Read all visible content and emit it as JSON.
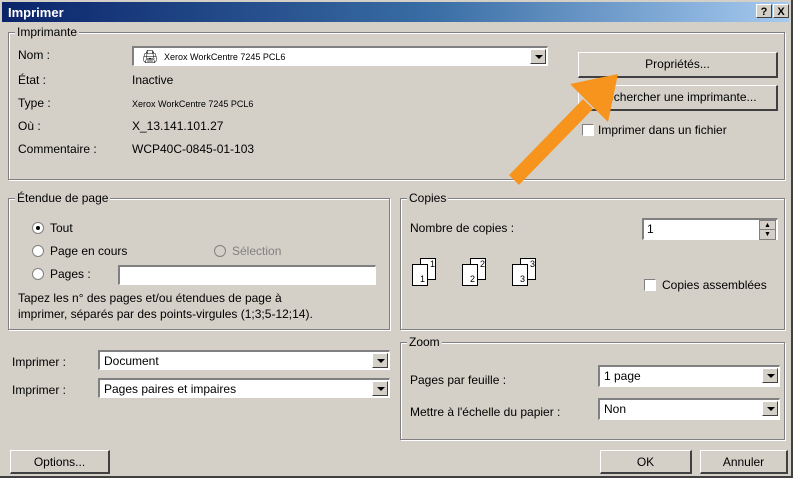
{
  "window": {
    "title": "Imprimer",
    "help_label": "?",
    "close_label": "X"
  },
  "printer": {
    "group_label": "Imprimante",
    "name_label": "Nom :",
    "name_value": "Xerox WorkCentre 7245 PCL6",
    "state_label": "État :",
    "state_value": "Inactive",
    "type_label": "Type :",
    "type_value": "Xerox WorkCentre 7245 PCL6",
    "where_label": "Où :",
    "where_value": "X_13.141.101.27",
    "comment_label": "Commentaire :",
    "comment_value": "WCP40C-0845-01-103",
    "properties_button": "Propriétés...",
    "find_button": "Rechercher une imprimante...",
    "print_to_file_label": "Imprimer dans un fichier",
    "print_to_file_checked": false
  },
  "page_range": {
    "group_label": "Étendue de page",
    "all_label": "Tout",
    "current_label": "Page en cours",
    "selection_label": "Sélection",
    "pages_label": "Pages :",
    "pages_value": "",
    "selected": "all",
    "help_line1": "Tapez les n° des pages et/ou étendues de page à",
    "help_line2": "imprimer, séparés par des points-virgules (1;3;5-12;14)."
  },
  "copies": {
    "group_label": "Copies",
    "count_label": "Nombre de copies :",
    "count_value": "1",
    "collate_label": "Copies assemblées",
    "collate_checked": false,
    "pages_back": [
      "1",
      "2",
      "3"
    ],
    "pages_front": [
      "1",
      "2",
      "3"
    ]
  },
  "print_what": {
    "label": "Imprimer :",
    "value": "Document"
  },
  "print_range": {
    "label": "Imprimer :",
    "value": "Pages paires et impaires"
  },
  "zoom": {
    "group_label": "Zoom",
    "pages_per_sheet_label": "Pages par feuille :",
    "pages_per_sheet_value": "1 page",
    "scale_label": "Mettre à l'échelle du papier :",
    "scale_value": "Non"
  },
  "footer": {
    "options_button": "Options...",
    "ok_button": "OK",
    "cancel_button": "Annuler"
  },
  "colors": {
    "arrow": "#f7941d",
    "titlebar": "#0a246a",
    "dialog_bg": "#d4d0c8"
  }
}
